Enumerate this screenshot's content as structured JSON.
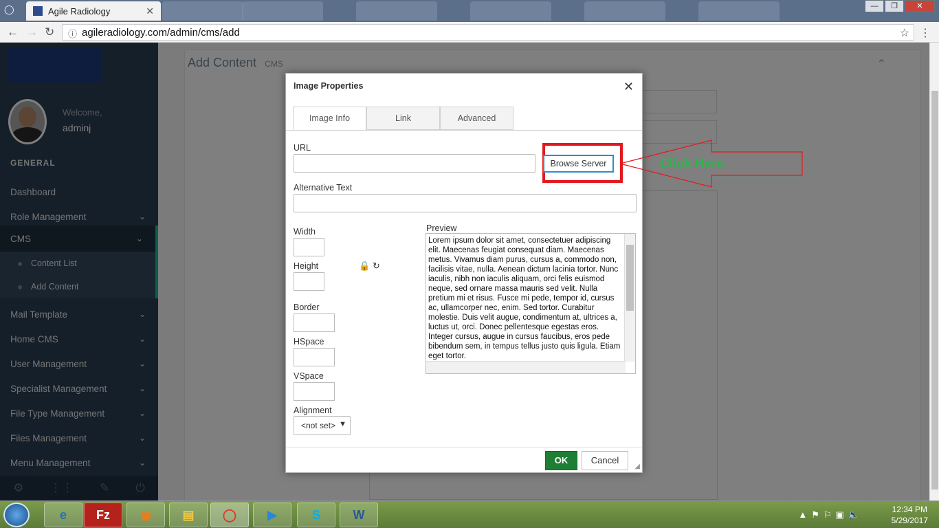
{
  "browser": {
    "active_tab_title": "Agile Radiology",
    "address": "agileradiology.com/admin/cms/add"
  },
  "sidebar": {
    "welcome": "Welcome,",
    "username": "adminj",
    "section": "GENERAL",
    "items": [
      {
        "label": "Dashboard"
      },
      {
        "label": "Role Management"
      },
      {
        "label": "CMS"
      },
      {
        "label": "Content List"
      },
      {
        "label": "Add Content"
      },
      {
        "label": "Mail Template"
      },
      {
        "label": "Home CMS"
      },
      {
        "label": "User Management"
      },
      {
        "label": "Specialist Management"
      },
      {
        "label": "File Type Management"
      },
      {
        "label": "Files Management"
      },
      {
        "label": "Menu Management"
      }
    ]
  },
  "page": {
    "title": "Add Content",
    "subtitle": "CMS"
  },
  "dialog": {
    "title": "Image Properties",
    "tabs": [
      "Image Info",
      "Link",
      "Advanced"
    ],
    "url_label": "URL",
    "browse_label": "Browse Server",
    "alt_label": "Alternative Text",
    "width_label": "Width",
    "height_label": "Height",
    "border_label": "Border",
    "hspace_label": "HSpace",
    "vspace_label": "VSpace",
    "alignment_label": "Alignment",
    "alignment_value": "<not set>",
    "preview_label": "Preview",
    "preview_text": "Lorem ipsum dolor sit amet, consectetuer adipiscing elit. Maecenas feugiat consequat diam. Maecenas metus. Vivamus diam purus, cursus a, commodo non, facilisis vitae, nulla. Aenean dictum lacinia tortor. Nunc iaculis, nibh non iaculis aliquam, orci felis euismod neque, sed ornare massa mauris sed velit. Nulla pretium mi et risus. Fusce mi pede, tempor id, cursus ac, ullamcorper nec, enim. Sed tortor. Curabitur molestie. Duis velit augue, condimentum at, ultrices a, luctus ut, orci. Donec pellentesque egestas eros. Integer cursus, augue in cursus faucibus, eros pede bibendum sem, in tempus tellus justo quis ligula. Etiam eget tortor.",
    "ok_label": "OK",
    "cancel_label": "Cancel"
  },
  "annotation": {
    "text": "Click Here",
    "color": "#2cb64a"
  },
  "taskbar": {
    "time": "12:34 PM",
    "date": "5/29/2017"
  }
}
